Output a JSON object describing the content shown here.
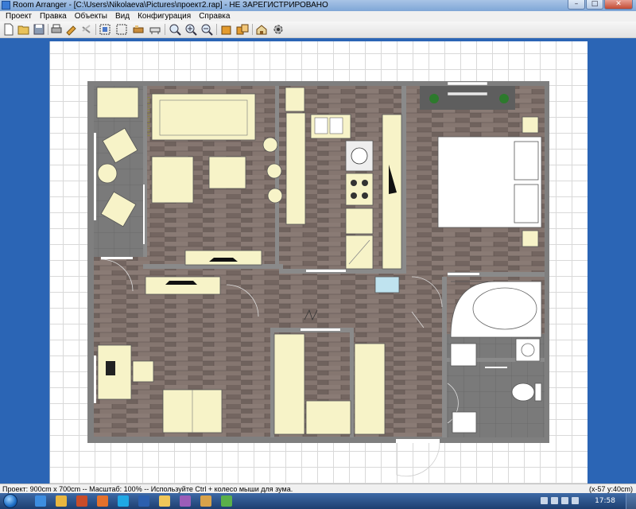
{
  "window": {
    "title": "Room Arranger - [C:\\Users\\Nikolaeva\\Pictures\\проект2.rap] - НЕ ЗАРЕГИСТРИРОВАНО",
    "minimize": "–",
    "maximize": "□",
    "close": "✕"
  },
  "menu": [
    "Проект",
    "Правка",
    "Объекты",
    "Вид",
    "Конфигурация",
    "Справка"
  ],
  "toolbar": {
    "buttons": [
      "new-file-icon",
      "open-folder-icon",
      "save-icon",
      "print-icon",
      "undo-icon",
      "redo-icon",
      "select-all-icon",
      "select-area-icon",
      "furniture-icon",
      "room-icon",
      "zoom-fit-icon",
      "zoom-in-icon",
      "zoom-out-icon",
      "object-icon",
      "group-icon",
      "3d-view-icon",
      "settings-icon"
    ]
  },
  "colors": {
    "wall": "#7f7f7f",
    "floor_wood": "#7e6f6a",
    "floor_tile": "#767676",
    "furniture": "#f7f3c8",
    "accent_blue": "#2b65b5"
  },
  "status": {
    "left": "Проект: 900cm x 700cm -- Масштаб: 100% -- Используйте Ctrl + колесо мыши для зума.",
    "right": "(x-57 y:40cm)"
  },
  "taskbar": {
    "time": "17:58",
    "apps": [
      "ie-icon",
      "explorer-icon",
      "media-icon",
      "firefox-icon",
      "skype-icon",
      "word-icon",
      "folder-icon",
      "paint-icon",
      "room-arranger-icon",
      "help-icon"
    ]
  }
}
